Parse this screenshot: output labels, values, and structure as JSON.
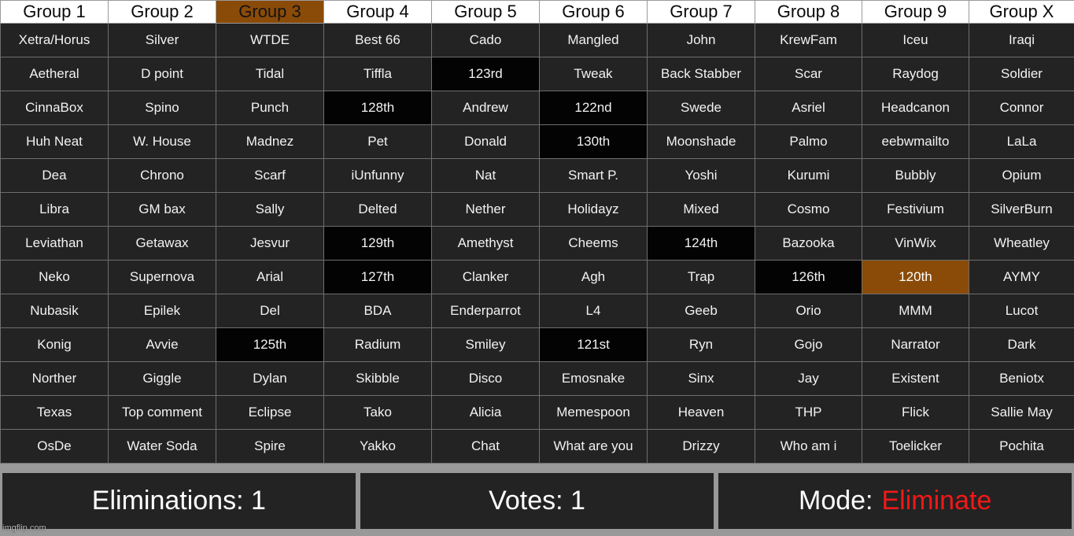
{
  "table": {
    "headers": [
      {
        "label": "Group 1",
        "state": "normal"
      },
      {
        "label": "Group 2",
        "state": "normal"
      },
      {
        "label": "Group 3",
        "state": "selected"
      },
      {
        "label": "Group 4",
        "state": "normal"
      },
      {
        "label": "Group 5",
        "state": "normal"
      },
      {
        "label": "Group 6",
        "state": "normal"
      },
      {
        "label": "Group 7",
        "state": "normal"
      },
      {
        "label": "Group 8",
        "state": "normal"
      },
      {
        "label": "Group 9",
        "state": "normal"
      },
      {
        "label": "Group X",
        "state": "normal"
      }
    ],
    "rows": [
      [
        {
          "text": "Xetra/Horus",
          "state": "normal"
        },
        {
          "text": "Silver",
          "state": "normal"
        },
        {
          "text": "WTDE",
          "state": "normal"
        },
        {
          "text": "Best 66",
          "state": "normal"
        },
        {
          "text": "Cado",
          "state": "normal"
        },
        {
          "text": "Mangled",
          "state": "normal"
        },
        {
          "text": "John",
          "state": "normal"
        },
        {
          "text": "KrewFam",
          "state": "normal"
        },
        {
          "text": "Iceu",
          "state": "normal"
        },
        {
          "text": "Iraqi",
          "state": "normal"
        }
      ],
      [
        {
          "text": "Aetheral",
          "state": "normal"
        },
        {
          "text": "D point",
          "state": "normal"
        },
        {
          "text": "Tidal",
          "state": "normal"
        },
        {
          "text": "Tiffla",
          "state": "normal"
        },
        {
          "text": "123rd",
          "state": "eliminated"
        },
        {
          "text": "Tweak",
          "state": "normal"
        },
        {
          "text": "Back Stabber",
          "state": "normal"
        },
        {
          "text": "Scar",
          "state": "normal"
        },
        {
          "text": "Raydog",
          "state": "normal"
        },
        {
          "text": "Soldier",
          "state": "normal"
        }
      ],
      [
        {
          "text": "CinnaBox",
          "state": "normal"
        },
        {
          "text": "Spino",
          "state": "normal"
        },
        {
          "text": "Punch",
          "state": "normal"
        },
        {
          "text": "128th",
          "state": "eliminated"
        },
        {
          "text": "Andrew",
          "state": "normal"
        },
        {
          "text": "122nd",
          "state": "eliminated"
        },
        {
          "text": "Swede",
          "state": "normal"
        },
        {
          "text": "Asriel",
          "state": "normal"
        },
        {
          "text": "Headcanon",
          "state": "normal"
        },
        {
          "text": "Connor",
          "state": "normal"
        }
      ],
      [
        {
          "text": "Huh Neat",
          "state": "normal"
        },
        {
          "text": "W. House",
          "state": "normal"
        },
        {
          "text": "Madnez",
          "state": "normal"
        },
        {
          "text": "Pet",
          "state": "normal"
        },
        {
          "text": "Donald",
          "state": "normal"
        },
        {
          "text": "130th",
          "state": "eliminated"
        },
        {
          "text": "Moonshade",
          "state": "normal"
        },
        {
          "text": "Palmo",
          "state": "normal"
        },
        {
          "text": "eebwmailto",
          "state": "normal"
        },
        {
          "text": "LaLa",
          "state": "normal"
        }
      ],
      [
        {
          "text": "Dea",
          "state": "normal"
        },
        {
          "text": "Chrono",
          "state": "normal"
        },
        {
          "text": "Scarf",
          "state": "normal"
        },
        {
          "text": "iUnfunny",
          "state": "normal"
        },
        {
          "text": "Nat",
          "state": "normal"
        },
        {
          "text": "Smart P.",
          "state": "normal"
        },
        {
          "text": "Yoshi",
          "state": "normal"
        },
        {
          "text": "Kurumi",
          "state": "normal"
        },
        {
          "text": "Bubbly",
          "state": "normal"
        },
        {
          "text": "Opium",
          "state": "normal"
        }
      ],
      [
        {
          "text": "Libra",
          "state": "normal"
        },
        {
          "text": "GM bax",
          "state": "normal"
        },
        {
          "text": "Sally",
          "state": "normal"
        },
        {
          "text": "Delted",
          "state": "normal"
        },
        {
          "text": "Nether",
          "state": "normal"
        },
        {
          "text": "Holidayz",
          "state": "normal"
        },
        {
          "text": "Mixed",
          "state": "normal"
        },
        {
          "text": "Cosmo",
          "state": "normal"
        },
        {
          "text": "Festivium",
          "state": "normal"
        },
        {
          "text": "SilverBurn",
          "state": "normal"
        }
      ],
      [
        {
          "text": "Leviathan",
          "state": "normal"
        },
        {
          "text": "Getawax",
          "state": "normal"
        },
        {
          "text": "Jesvur",
          "state": "normal"
        },
        {
          "text": "129th",
          "state": "eliminated"
        },
        {
          "text": "Amethyst",
          "state": "normal"
        },
        {
          "text": "Cheems",
          "state": "normal"
        },
        {
          "text": "124th",
          "state": "eliminated"
        },
        {
          "text": "Bazooka",
          "state": "normal"
        },
        {
          "text": "VinWix",
          "state": "normal"
        },
        {
          "text": "Wheatley",
          "state": "normal"
        }
      ],
      [
        {
          "text": "Neko",
          "state": "normal"
        },
        {
          "text": "Supernova",
          "state": "normal"
        },
        {
          "text": "Arial",
          "state": "normal"
        },
        {
          "text": "127th",
          "state": "eliminated"
        },
        {
          "text": "Clanker",
          "state": "normal"
        },
        {
          "text": "Agh",
          "state": "normal"
        },
        {
          "text": "Trap",
          "state": "normal"
        },
        {
          "text": "126th",
          "state": "eliminated"
        },
        {
          "text": "120th",
          "state": "selected"
        },
        {
          "text": "AYMY",
          "state": "normal"
        }
      ],
      [
        {
          "text": "Nubasik",
          "state": "normal"
        },
        {
          "text": "Epilek",
          "state": "normal"
        },
        {
          "text": "Del",
          "state": "normal"
        },
        {
          "text": "BDA",
          "state": "normal"
        },
        {
          "text": "Enderparrot",
          "state": "normal"
        },
        {
          "text": "L4",
          "state": "normal"
        },
        {
          "text": "Geeb",
          "state": "normal"
        },
        {
          "text": "Orio",
          "state": "normal"
        },
        {
          "text": "MMM",
          "state": "normal"
        },
        {
          "text": "Lucot",
          "state": "normal"
        }
      ],
      [
        {
          "text": "Konig",
          "state": "normal"
        },
        {
          "text": "Avvie",
          "state": "normal"
        },
        {
          "text": "125th",
          "state": "eliminated"
        },
        {
          "text": "Radium",
          "state": "normal"
        },
        {
          "text": "Smiley",
          "state": "normal"
        },
        {
          "text": "121st",
          "state": "eliminated"
        },
        {
          "text": "Ryn",
          "state": "normal"
        },
        {
          "text": "Gojo",
          "state": "normal"
        },
        {
          "text": "Narrator",
          "state": "normal"
        },
        {
          "text": "Dark",
          "state": "normal"
        }
      ],
      [
        {
          "text": "Norther",
          "state": "normal"
        },
        {
          "text": "Giggle",
          "state": "normal"
        },
        {
          "text": "Dylan",
          "state": "normal"
        },
        {
          "text": "Skibble",
          "state": "normal"
        },
        {
          "text": "Disco",
          "state": "normal"
        },
        {
          "text": "Emosnake",
          "state": "normal"
        },
        {
          "text": "Sinx",
          "state": "normal"
        },
        {
          "text": "Jay",
          "state": "normal"
        },
        {
          "text": "Existent",
          "state": "normal"
        },
        {
          "text": "Beniotx",
          "state": "normal"
        }
      ],
      [
        {
          "text": "Texas",
          "state": "normal"
        },
        {
          "text": "Top comment",
          "state": "normal"
        },
        {
          "text": "Eclipse",
          "state": "normal"
        },
        {
          "text": "Tako",
          "state": "normal"
        },
        {
          "text": "Alicia",
          "state": "normal"
        },
        {
          "text": "Memespoon",
          "state": "normal"
        },
        {
          "text": "Heaven",
          "state": "normal"
        },
        {
          "text": "THP",
          "state": "normal"
        },
        {
          "text": "Flick",
          "state": "normal"
        },
        {
          "text": "Sallie May",
          "state": "normal"
        }
      ],
      [
        {
          "text": "OsDe",
          "state": "normal"
        },
        {
          "text": "Water Soda",
          "state": "normal"
        },
        {
          "text": "Spire",
          "state": "normal"
        },
        {
          "text": "Yakko",
          "state": "normal"
        },
        {
          "text": "Chat",
          "state": "normal"
        },
        {
          "text": "What are you",
          "state": "normal"
        },
        {
          "text": "Drizzy",
          "state": "normal"
        },
        {
          "text": "Who am i",
          "state": "normal"
        },
        {
          "text": "Toelicker",
          "state": "normal"
        },
        {
          "text": "Pochita",
          "state": "normal"
        }
      ]
    ]
  },
  "status": {
    "eliminations": "Eliminations: 1",
    "votes": "Votes: 1",
    "mode_label": "Mode:",
    "mode_value": "Eliminate"
  },
  "watermark": "imgflip.com",
  "colors": {
    "selected": "#8a4b08",
    "eliminated": "#030303",
    "cell": "#232323",
    "header": "#ffffff",
    "frame": "#999999",
    "mode_value": "#f21818"
  }
}
